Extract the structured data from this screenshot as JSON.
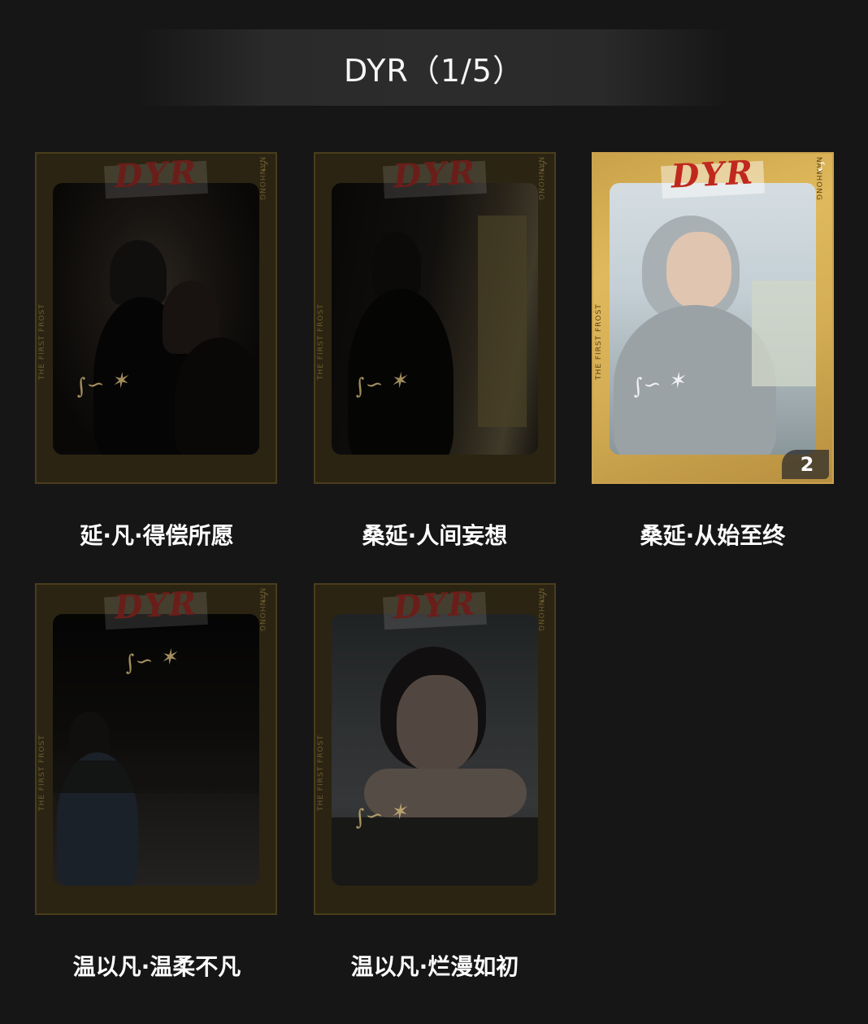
{
  "header": {
    "title": "DYR（1/5）"
  },
  "cards": [
    {
      "label": "延·凡·得偿所愿",
      "tape": "DYR",
      "left_text": "THE FIRST FROST",
      "right_text": "NANHONG",
      "badge": ""
    },
    {
      "label": "桑延·人间妄想",
      "tape": "DYR",
      "left_text": "THE FIRST FROST",
      "right_text": "NANHONG",
      "badge": ""
    },
    {
      "label": "桑延·从始至终",
      "tape": "DYR",
      "left_text": "THE FIRST FROST",
      "right_text": "NANHONG",
      "badge": "2"
    },
    {
      "label": "温以凡·温柔不凡",
      "tape": "DYR",
      "left_text": "THE FIRST FROST",
      "right_text": "NANHONG",
      "badge": ""
    },
    {
      "label": "温以凡·烂漫如初",
      "tape": "DYR",
      "left_text": "THE FIRST FROST",
      "right_text": "NANHONG",
      "badge": ""
    }
  ],
  "colors": {
    "background": "#161616",
    "card_gold": "#d4ad55",
    "tape_red": "#c0281e"
  },
  "icons": {
    "card_logo": "tiktok-icon"
  }
}
